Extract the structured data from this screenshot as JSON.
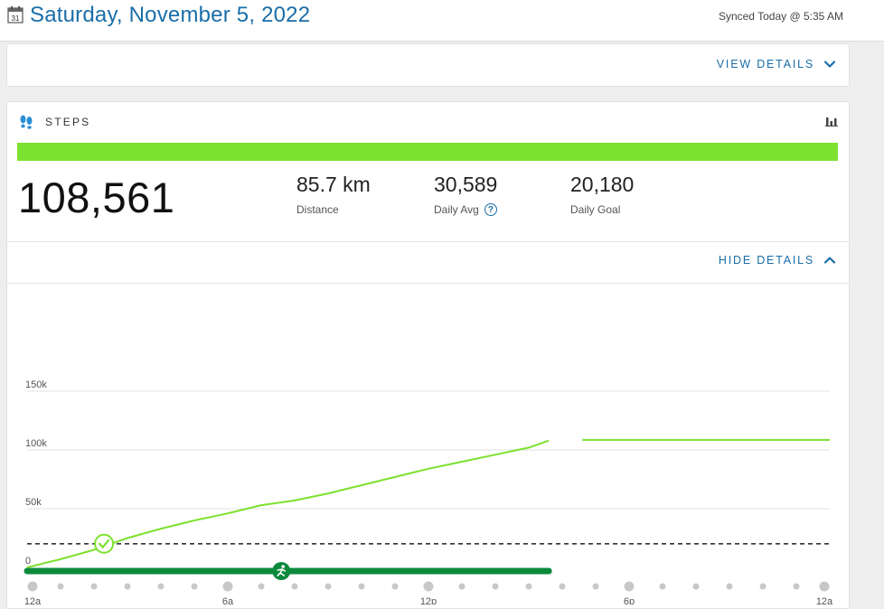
{
  "header": {
    "date": "Saturday, November 5, 2022",
    "synced": "Synced Today @ 5:35 AM",
    "calendar_day": "31"
  },
  "card1": {
    "view_details": "VIEW DETAILS"
  },
  "steps": {
    "label": "STEPS",
    "progress_fraction": 1.0,
    "total": "108,561",
    "distance_value": "85.7 km",
    "distance_label": "Distance",
    "avg_value": "30,589",
    "avg_label": "Daily Avg",
    "goal_value": "20,180",
    "goal_label": "Daily Goal",
    "hide_details": "HIDE DETAILS"
  },
  "colors": {
    "accent": "#1a6ea8",
    "progress": "#7de130",
    "line": "#7de130",
    "activity": "#0b8a3c",
    "goal_line": "#333333",
    "dot": "#c8c8c8"
  },
  "chart_data": {
    "type": "line",
    "ylim": [
      0,
      150000
    ],
    "xlim": [
      0,
      24
    ],
    "y_ticks": [
      {
        "value": 0,
        "label": "0"
      },
      {
        "value": 50000,
        "label": "50k"
      },
      {
        "value": 100000,
        "label": "100k"
      },
      {
        "value": 150000,
        "label": "150k"
      }
    ],
    "x_ticks": [
      {
        "value": 0,
        "label": "12a"
      },
      {
        "value": 6,
        "label": "6a"
      },
      {
        "value": 12,
        "label": "12p"
      },
      {
        "value": 18,
        "label": "6p"
      },
      {
        "value": 24,
        "label": "12a"
      }
    ],
    "goal": 20180,
    "goal_reached_hour": 2.3,
    "series": [
      {
        "segments": [
          [
            [
              0,
              0
            ],
            [
              1,
              7000
            ],
            [
              2,
              15000
            ],
            [
              3,
              25000
            ],
            [
              4,
              33000
            ],
            [
              5,
              40000
            ],
            [
              6,
              46000
            ],
            [
              7,
              53000
            ],
            [
              8,
              57000
            ],
            [
              9,
              63000
            ],
            [
              10,
              70000
            ],
            [
              11,
              77000
            ],
            [
              12,
              84000
            ],
            [
              13,
              90000
            ],
            [
              14,
              96000
            ],
            [
              15,
              102000
            ],
            [
              15.6,
              108000
            ]
          ],
          [
            [
              16.6,
              108500
            ],
            [
              20,
              108500
            ],
            [
              24,
              108561
            ]
          ]
        ]
      }
    ],
    "activity_bar": [
      0,
      15.6
    ],
    "activity_icon_hour": 7.6,
    "dots_hours": [
      0,
      1,
      2,
      3,
      4,
      5,
      6,
      7,
      8,
      9,
      10,
      11,
      12,
      13,
      14,
      15,
      16,
      17,
      18,
      19,
      20,
      21,
      22,
      23,
      24
    ]
  }
}
